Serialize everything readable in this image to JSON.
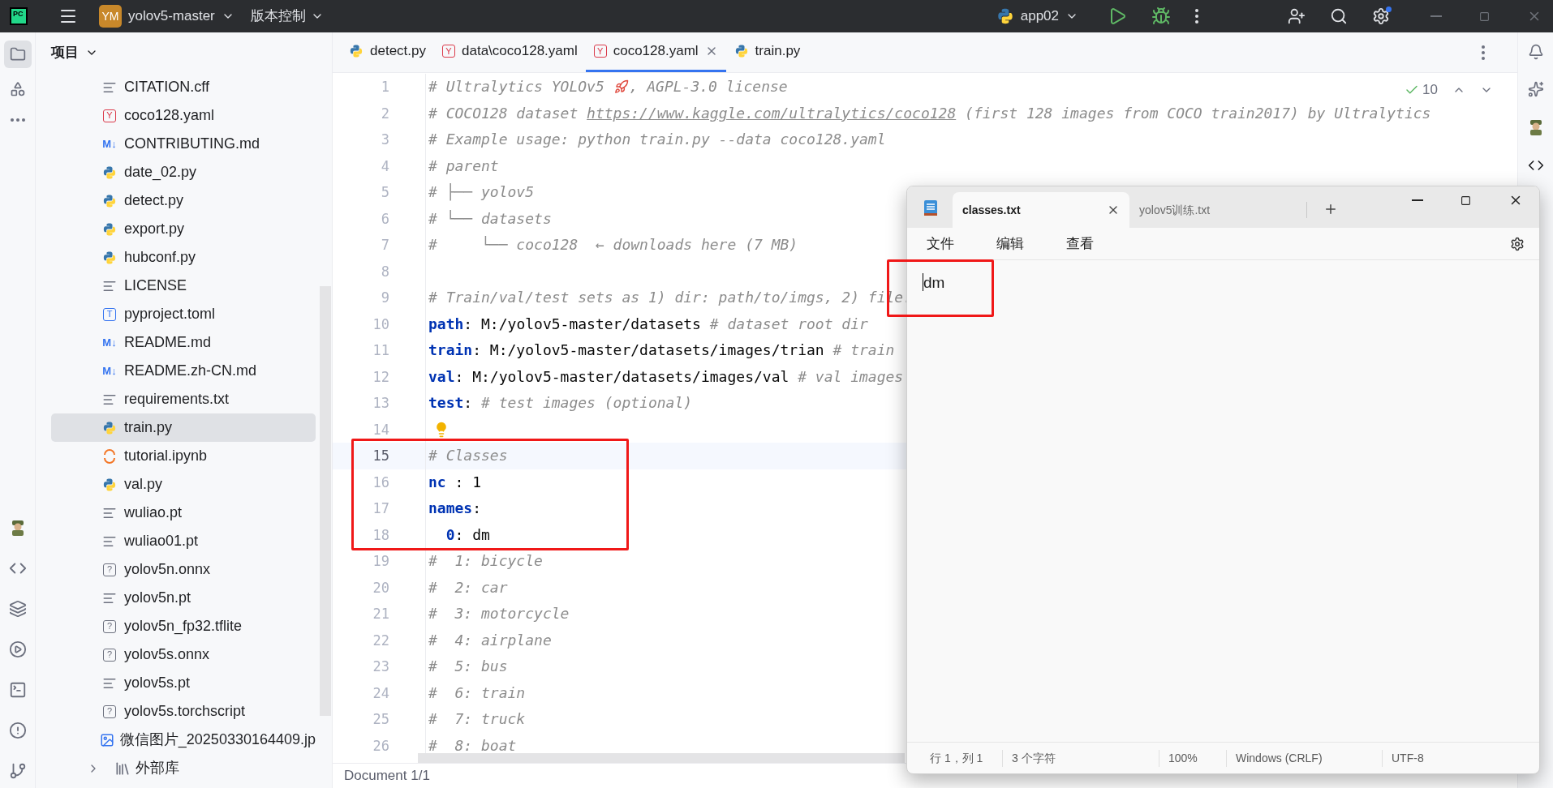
{
  "header": {
    "logo": "PC",
    "project_badge": "YM",
    "project": "yolov5-master",
    "vcs": "版本控制",
    "run_config": "app02"
  },
  "project_panel": {
    "title": "项目",
    "files": [
      {
        "name": "CITATION.cff",
        "kind": "text",
        "selected": false
      },
      {
        "name": "coco128.yaml",
        "kind": "yaml",
        "badge": "Y",
        "selected": false
      },
      {
        "name": "CONTRIBUTING.md",
        "kind": "md",
        "badge": "M↓",
        "selected": false
      },
      {
        "name": "date_02.py",
        "kind": "py",
        "selected": false
      },
      {
        "name": "detect.py",
        "kind": "py",
        "selected": false
      },
      {
        "name": "export.py",
        "kind": "py",
        "selected": false
      },
      {
        "name": "hubconf.py",
        "kind": "py",
        "selected": false
      },
      {
        "name": "LICENSE",
        "kind": "text",
        "selected": false
      },
      {
        "name": "pyproject.toml",
        "kind": "toml",
        "badge": "T",
        "selected": false
      },
      {
        "name": "README.md",
        "kind": "md",
        "badge": "M↓",
        "selected": false
      },
      {
        "name": "README.zh-CN.md",
        "kind": "md",
        "badge": "M↓",
        "selected": false
      },
      {
        "name": "requirements.txt",
        "kind": "text",
        "selected": false
      },
      {
        "name": "train.py",
        "kind": "py",
        "selected": true
      },
      {
        "name": "tutorial.ipynb",
        "kind": "ipynb",
        "selected": false
      },
      {
        "name": "val.py",
        "kind": "py",
        "selected": false
      },
      {
        "name": "wuliao.pt",
        "kind": "text",
        "selected": false
      },
      {
        "name": "wuliao01.pt",
        "kind": "text",
        "selected": false
      },
      {
        "name": "yolov5n.onnx",
        "kind": "unknown",
        "badge": "?",
        "selected": false
      },
      {
        "name": "yolov5n.pt",
        "kind": "text",
        "selected": false
      },
      {
        "name": "yolov5n_fp32.tflite",
        "kind": "unknown",
        "badge": "?",
        "selected": false
      },
      {
        "name": "yolov5s.onnx",
        "kind": "unknown",
        "badge": "?",
        "selected": false
      },
      {
        "name": "yolov5s.pt",
        "kind": "text",
        "selected": false
      },
      {
        "name": "yolov5s.torchscript",
        "kind": "unknown",
        "badge": "?",
        "selected": false
      },
      {
        "name": "微信图片_20250330164409.jp",
        "kind": "image",
        "selected": false
      }
    ],
    "external": "外部库",
    "external_expanded": false
  },
  "editor": {
    "tabs": [
      {
        "label": "detect.py",
        "kind": "py",
        "selected": false
      },
      {
        "label": "data\\coco128.yaml",
        "kind": "yaml",
        "badge": "Y",
        "selected": false
      },
      {
        "label": "coco128.yaml",
        "kind": "yaml",
        "badge": "Y",
        "selected": true
      },
      {
        "label": "train.py",
        "kind": "py",
        "selected": false
      }
    ],
    "inspections": "10",
    "lines": [
      {
        "number": "1",
        "current": false,
        "parts": [
          {
            "kind": "comment",
            "text": "# Ultralytics YOLOv5 "
          },
          {
            "kind": "rocket"
          },
          {
            "kind": "comment",
            "text": ", AGPL-3.0 license"
          }
        ]
      },
      {
        "number": "2",
        "current": false,
        "parts": [
          {
            "kind": "comment",
            "text": "# COCO128 dataset "
          },
          {
            "kind": "link",
            "text": "https://www.kaggle.com/ultralytics/coco128"
          },
          {
            "kind": "comment",
            "text": " (first 128 images from COCO train2017) by Ultralytics"
          }
        ]
      },
      {
        "number": "3",
        "current": false,
        "parts": [
          {
            "kind": "comment",
            "text": "# Example usage: python train.py --data coco128.yaml"
          }
        ]
      },
      {
        "number": "4",
        "current": false,
        "parts": [
          {
            "kind": "comment",
            "text": "# parent"
          }
        ]
      },
      {
        "number": "5",
        "current": false,
        "parts": [
          {
            "kind": "comment",
            "text": "# ├── yolov5"
          }
        ]
      },
      {
        "number": "6",
        "current": false,
        "parts": [
          {
            "kind": "comment",
            "text": "# └── datasets"
          }
        ]
      },
      {
        "number": "7",
        "current": false,
        "parts": [
          {
            "kind": "comment",
            "text": "#     └── coco128  ← downloads here (7 MB)"
          }
        ]
      },
      {
        "number": "8",
        "current": false
      },
      {
        "number": "9",
        "current": false,
        "parts": [
          {
            "kind": "comment",
            "text": "# Train/val/test sets as 1) dir: path/to/imgs, 2) file."
          }
        ]
      },
      {
        "number": "10",
        "current": false,
        "parts": [
          {
            "kind": "key",
            "text": "path"
          },
          {
            "kind": "plain",
            "text": ": M:/yolov5-master/datasets "
          },
          {
            "kind": "comment",
            "text": "# dataset root dir"
          }
        ]
      },
      {
        "number": "11",
        "current": false,
        "parts": [
          {
            "kind": "key",
            "text": "train"
          },
          {
            "kind": "plain",
            "text": ": M:/yolov5-master/datasets/images/trian "
          },
          {
            "kind": "comment",
            "text": "# train"
          }
        ]
      },
      {
        "number": "12",
        "current": false,
        "parts": [
          {
            "kind": "key",
            "text": "val"
          },
          {
            "kind": "plain",
            "text": ": M:/yolov5-master/datasets/images/val "
          },
          {
            "kind": "comment",
            "text": "# val images"
          }
        ]
      },
      {
        "number": "13",
        "current": false,
        "parts": [
          {
            "kind": "key",
            "text": "test"
          },
          {
            "kind": "plain",
            "text": ": "
          },
          {
            "kind": "comment",
            "text": "# test images (optional)"
          }
        ]
      },
      {
        "number": "14",
        "current": false,
        "parts": [
          {
            "kind": "bulb"
          }
        ]
      },
      {
        "number": "15",
        "current": true,
        "parts": [
          {
            "kind": "comment",
            "text": "# Classes"
          }
        ]
      },
      {
        "number": "16",
        "current": false,
        "parts": [
          {
            "kind": "key",
            "text": "nc"
          },
          {
            "kind": "plain",
            "text": " : 1"
          }
        ]
      },
      {
        "number": "17",
        "current": false,
        "parts": [
          {
            "kind": "key",
            "text": "names"
          },
          {
            "kind": "plain",
            "text": ":"
          }
        ]
      },
      {
        "number": "18",
        "current": false,
        "parts": [
          {
            "kind": "key",
            "text": "  0"
          },
          {
            "kind": "plain",
            "text": ": dm"
          }
        ]
      },
      {
        "number": "19",
        "current": false,
        "parts": [
          {
            "kind": "comment",
            "text": "#  1: bicycle"
          }
        ]
      },
      {
        "number": "20",
        "current": false,
        "parts": [
          {
            "kind": "comment",
            "text": "#  2: car"
          }
        ]
      },
      {
        "number": "21",
        "current": false,
        "parts": [
          {
            "kind": "comment",
            "text": "#  3: motorcycle"
          }
        ]
      },
      {
        "number": "22",
        "current": false,
        "parts": [
          {
            "kind": "comment",
            "text": "#  4: airplane"
          }
        ]
      },
      {
        "number": "23",
        "current": false,
        "parts": [
          {
            "kind": "comment",
            "text": "#  5: bus"
          }
        ]
      },
      {
        "number": "24",
        "current": false,
        "parts": [
          {
            "kind": "comment",
            "text": "#  6: train"
          }
        ]
      },
      {
        "number": "25",
        "current": false,
        "parts": [
          {
            "kind": "comment",
            "text": "#  7: truck"
          }
        ]
      },
      {
        "number": "26",
        "current": false,
        "parts": [
          {
            "kind": "comment",
            "text": "#  8: boat"
          }
        ]
      }
    ],
    "status": "Document 1/1"
  },
  "notepad": {
    "tabs": [
      {
        "label": "classes.txt",
        "selected": true
      },
      {
        "label": "yolov5训练.txt",
        "selected": false
      }
    ],
    "menu": [
      "文件",
      "编辑",
      "查看"
    ],
    "text": "dm",
    "status": [
      "行 1，列 1",
      "3 个字符",
      "100%",
      "Windows (CRLF)",
      "UTF-8"
    ]
  }
}
